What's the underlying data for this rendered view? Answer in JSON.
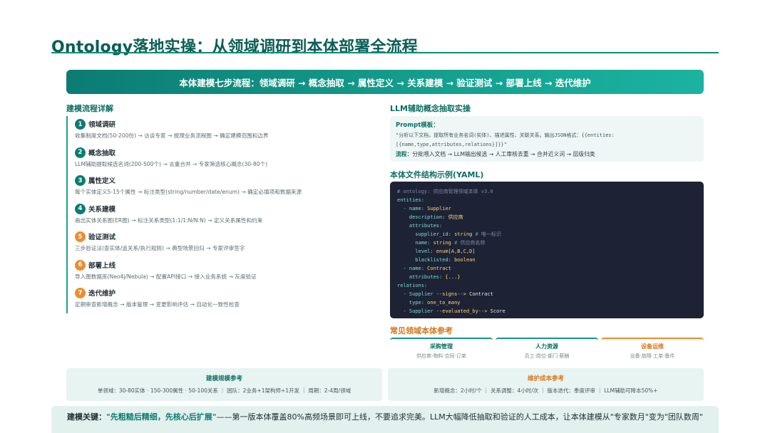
{
  "page": {
    "title": "Ontology落地实操：从领域调研到本体部署全流程",
    "banner": "本体建模七步流程：领域调研 → 概念抽取 → 属性定义 → 关系建模 → 验证测试 → 部署上线 → 迭代维护"
  },
  "process": {
    "heading": "建模流程详解",
    "steps": [
      {
        "num": "1",
        "name": "领域调研",
        "desc": "收集制度文档(50-200份) → 访谈专家 → 梳理业务流程图 → 确定建模范围和边界"
      },
      {
        "num": "2",
        "name": "概念抽取",
        "desc": "LLM辅助提取候选名词(200-500个) → 去重合并 → 专家筛选核心概念(30-80个)"
      },
      {
        "num": "3",
        "name": "属性定义",
        "desc": "每个实体定义5-15个属性 → 标注类型(string/number/date/enum) → 确定必填项和数据来源"
      },
      {
        "num": "4",
        "name": "关系建模",
        "desc": "画出实体关系图(ER图) → 标注关系类型(1:1/1:N/N:N) → 定义关系属性和约束"
      },
      {
        "num": "5",
        "name": "验证测试",
        "desc": "三步验证法(查实体/追关系/执行规则) → 典型场景回归 → 专家评审签字"
      },
      {
        "num": "6",
        "name": "部署上线",
        "desc": "导入图数据库(Neo4j/Nebula) → 配置API接口 → 接入业务系统 → 灰度验证"
      },
      {
        "num": "7",
        "name": "迭代维护",
        "desc": "定期审查新增概念 → 版本管理 → 变更影响评估 → 自动化一致性检查"
      }
    ]
  },
  "llm": {
    "heading": "LLM辅助概念抽取实操",
    "prompt_label": "Prompt模板：",
    "prompt_text_1": "\"分析以下文档，提取所有业务名词(实体)、描述属性、关联关系。输出JSON格式：{{entities:",
    "prompt_text_2": "[{name,type,attributes,relations}]}}\"",
    "flow_label": "流程：",
    "flow_text": "分批喂入文档 → LLM输出候选 → 人工审核去重 → 合并近义词 → 层级归类"
  },
  "yaml": {
    "heading": "本体文件结构示例(YAML)",
    "lines": [
      {
        "indent": "",
        "key": "",
        "val": "",
        "comment": "# ontology: 供应商管理领域本体 v3.0"
      },
      {
        "indent": "",
        "key": "entities:",
        "val": "",
        "comment": ""
      },
      {
        "indent": "  ",
        "key": "- name:",
        "val": " Supplier",
        "comment": ""
      },
      {
        "indent": "    ",
        "key": "description:",
        "val": " 供应商",
        "comment": ""
      },
      {
        "indent": "    ",
        "key": "attributes:",
        "val": "",
        "comment": ""
      },
      {
        "indent": "      ",
        "key": "supplier_id:",
        "val": " string",
        "comment": " # 唯一标识"
      },
      {
        "indent": "      ",
        "key": "name:",
        "val": " string",
        "comment": " # 供应商名称"
      },
      {
        "indent": "      ",
        "key": "level:",
        "val": " enum[A,B,C,D]",
        "comment": ""
      },
      {
        "indent": "      ",
        "key": "blacklisted:",
        "val": " boolean",
        "comment": ""
      },
      {
        "indent": "  ",
        "key": "- name:",
        "val": " Contract",
        "comment": ""
      },
      {
        "indent": "    ",
        "key": "attributes:",
        "val": " {...}",
        "comment": ""
      },
      {
        "indent": "",
        "key": "relations:",
        "val": "",
        "comment": ""
      },
      {
        "indent": "  ",
        "key": "- Supplier",
        "val": " --signs-->",
        "comment": " Contract"
      },
      {
        "indent": "    ",
        "key": "type:",
        "val": " one_to_many",
        "comment": ""
      },
      {
        "indent": "  ",
        "key": "- Supplier",
        "val": " --evaluated_by-->",
        "comment": " Score"
      }
    ]
  },
  "references": {
    "heading": "常见领域本体参考",
    "tabs": [
      {
        "name": "采购管理",
        "items": "供应商·物料·合同·订单",
        "accent": "teal"
      },
      {
        "name": "人力资源",
        "items": "员工·岗位·部门·薪酬",
        "accent": "teal"
      },
      {
        "name": "设备运维",
        "items": "设备·故障·工单·备件",
        "accent": "orange"
      }
    ]
  },
  "scale_card": {
    "title": "建模规模参考",
    "text": "单领域：30-80实体 · 150-300属性 · 50-100关系 ｜ 团队：2业务+1架构师+1开发 ｜ 周期：2-4周/领域"
  },
  "cost_card": {
    "title": "维护成本参考",
    "text": "新增概念：2小时/个 ｜ 关系调整：4小时/次 ｜ 版本迭代：季度评审 ｜ LLM辅助可降本50%+"
  },
  "key_point": {
    "label": "建模关键：",
    "emphasis": "\"先粗糙后精细，先核心后扩展\"",
    "text": "——第一版本体覆盖80%高频场景即可上线，不要追求完美。LLM大幅降低抽取和验证的人工成本，让本体建模从\"专家数月\"变为\"团队数周\""
  },
  "colors": {
    "primary": "#0c7c72",
    "accent": "#f08b2c",
    "code_bg": "#1d2235"
  }
}
